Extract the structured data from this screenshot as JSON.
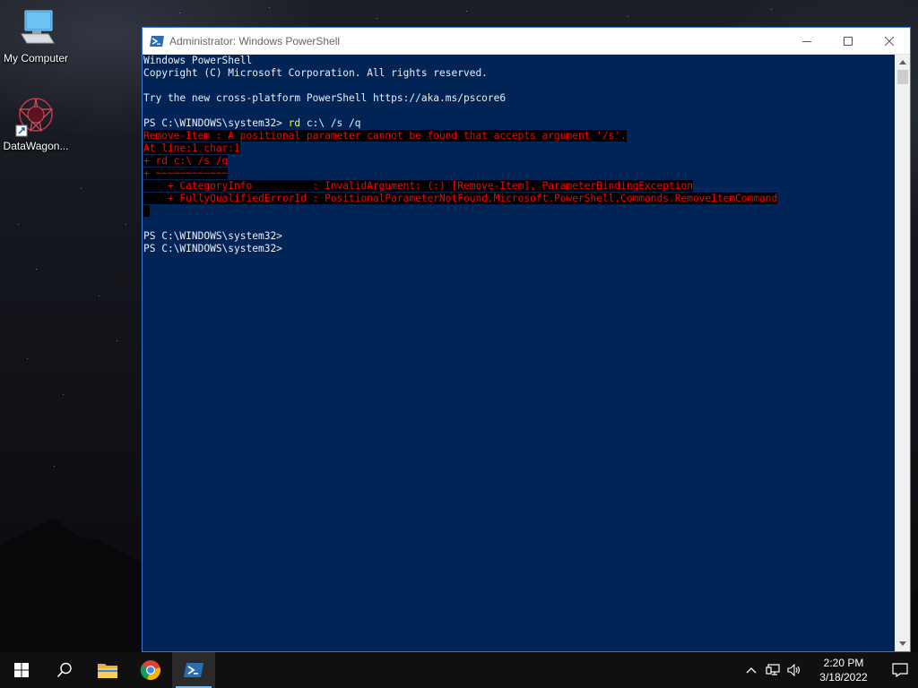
{
  "desktop": {
    "icons": [
      {
        "label": "My Computer",
        "icon": "computer-icon"
      },
      {
        "label": "DataWagon...",
        "icon": "datawagon-app-icon"
      }
    ]
  },
  "window": {
    "title": "Administrator: Windows PowerShell",
    "icon": "powershell-icon",
    "controls": {
      "minimize": "minimize-icon",
      "maximize": "maximize-icon",
      "close": "close-icon"
    }
  },
  "console": {
    "banner": [
      "Windows PowerShell",
      "Copyright (C) Microsoft Corporation. All rights reserved.",
      "",
      "Try the new cross-platform PowerShell https://aka.ms/pscore6",
      ""
    ],
    "prompt": "PS C:\\WINDOWS\\system32> ",
    "command_name": "rd",
    "command_args": " c:\\ /s /q",
    "error_lines": [
      "Remove-Item : A positional parameter cannot be found that accepts argument '/s'.",
      "At line:1 char:1",
      "+ rd c:\\ /s /q",
      "+ ~~~~~~~~~~~~",
      "    + CategoryInfo          : InvalidArgument: (:) [Remove-Item], ParameterBindingException",
      "    + FullyQualifiedErrorId : PositionalParameterNotFound,Microsoft.PowerShell.Commands.RemoveItemCommand",
      " "
    ],
    "after_lines": [
      "",
      "PS C:\\WINDOWS\\system32>",
      "PS C:\\WINDOWS\\system32>"
    ],
    "colors": {
      "background": "#012456",
      "text": "#eeedf0",
      "error": "#ff0000",
      "command": "#ffff00"
    }
  },
  "taskbar": {
    "apps": [
      {
        "name": "start-button",
        "icon": "windows-logo-icon"
      },
      {
        "name": "search-button",
        "icon": "search-icon"
      },
      {
        "name": "file-explorer-button",
        "icon": "folder-icon"
      },
      {
        "name": "chrome-button",
        "icon": "chrome-icon"
      },
      {
        "name": "powershell-taskbar-button",
        "icon": "powershell-icon",
        "active": true
      }
    ],
    "tray": {
      "chevron": "chevron-up-icon",
      "network": "network-icon",
      "volume": "volume-icon",
      "time": "2:20 PM",
      "date": "3/18/2022",
      "notifications": "notification-icon"
    }
  }
}
